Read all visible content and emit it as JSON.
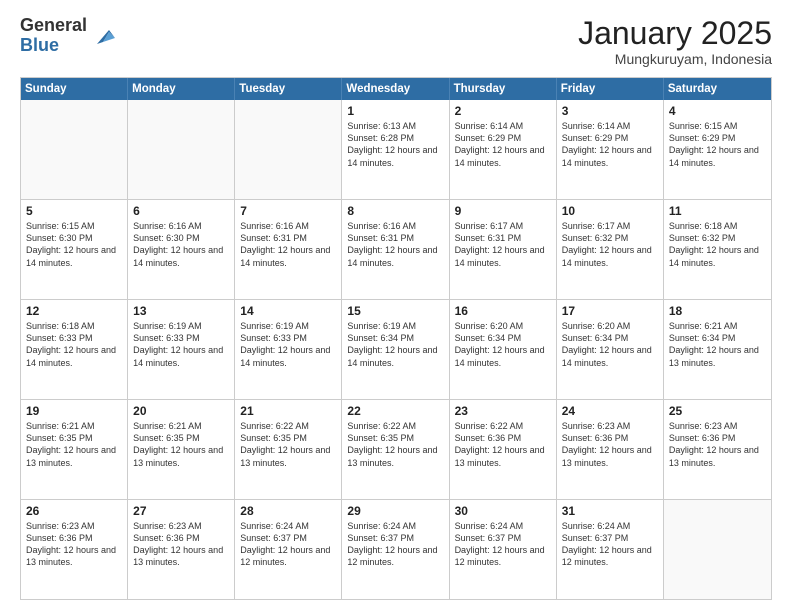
{
  "logo": {
    "general": "General",
    "blue": "Blue"
  },
  "header": {
    "month": "January 2025",
    "location": "Mungkuruyam, Indonesia"
  },
  "weekdays": [
    "Sunday",
    "Monday",
    "Tuesday",
    "Wednesday",
    "Thursday",
    "Friday",
    "Saturday"
  ],
  "weeks": [
    [
      {
        "day": "",
        "sunrise": "",
        "sunset": "",
        "daylight": ""
      },
      {
        "day": "",
        "sunrise": "",
        "sunset": "",
        "daylight": ""
      },
      {
        "day": "",
        "sunrise": "",
        "sunset": "",
        "daylight": ""
      },
      {
        "day": "1",
        "sunrise": "Sunrise: 6:13 AM",
        "sunset": "Sunset: 6:28 PM",
        "daylight": "Daylight: 12 hours and 14 minutes."
      },
      {
        "day": "2",
        "sunrise": "Sunrise: 6:14 AM",
        "sunset": "Sunset: 6:29 PM",
        "daylight": "Daylight: 12 hours and 14 minutes."
      },
      {
        "day": "3",
        "sunrise": "Sunrise: 6:14 AM",
        "sunset": "Sunset: 6:29 PM",
        "daylight": "Daylight: 12 hours and 14 minutes."
      },
      {
        "day": "4",
        "sunrise": "Sunrise: 6:15 AM",
        "sunset": "Sunset: 6:29 PM",
        "daylight": "Daylight: 12 hours and 14 minutes."
      }
    ],
    [
      {
        "day": "5",
        "sunrise": "Sunrise: 6:15 AM",
        "sunset": "Sunset: 6:30 PM",
        "daylight": "Daylight: 12 hours and 14 minutes."
      },
      {
        "day": "6",
        "sunrise": "Sunrise: 6:16 AM",
        "sunset": "Sunset: 6:30 PM",
        "daylight": "Daylight: 12 hours and 14 minutes."
      },
      {
        "day": "7",
        "sunrise": "Sunrise: 6:16 AM",
        "sunset": "Sunset: 6:31 PM",
        "daylight": "Daylight: 12 hours and 14 minutes."
      },
      {
        "day": "8",
        "sunrise": "Sunrise: 6:16 AM",
        "sunset": "Sunset: 6:31 PM",
        "daylight": "Daylight: 12 hours and 14 minutes."
      },
      {
        "day": "9",
        "sunrise": "Sunrise: 6:17 AM",
        "sunset": "Sunset: 6:31 PM",
        "daylight": "Daylight: 12 hours and 14 minutes."
      },
      {
        "day": "10",
        "sunrise": "Sunrise: 6:17 AM",
        "sunset": "Sunset: 6:32 PM",
        "daylight": "Daylight: 12 hours and 14 minutes."
      },
      {
        "day": "11",
        "sunrise": "Sunrise: 6:18 AM",
        "sunset": "Sunset: 6:32 PM",
        "daylight": "Daylight: 12 hours and 14 minutes."
      }
    ],
    [
      {
        "day": "12",
        "sunrise": "Sunrise: 6:18 AM",
        "sunset": "Sunset: 6:33 PM",
        "daylight": "Daylight: 12 hours and 14 minutes."
      },
      {
        "day": "13",
        "sunrise": "Sunrise: 6:19 AM",
        "sunset": "Sunset: 6:33 PM",
        "daylight": "Daylight: 12 hours and 14 minutes."
      },
      {
        "day": "14",
        "sunrise": "Sunrise: 6:19 AM",
        "sunset": "Sunset: 6:33 PM",
        "daylight": "Daylight: 12 hours and 14 minutes."
      },
      {
        "day": "15",
        "sunrise": "Sunrise: 6:19 AM",
        "sunset": "Sunset: 6:34 PM",
        "daylight": "Daylight: 12 hours and 14 minutes."
      },
      {
        "day": "16",
        "sunrise": "Sunrise: 6:20 AM",
        "sunset": "Sunset: 6:34 PM",
        "daylight": "Daylight: 12 hours and 14 minutes."
      },
      {
        "day": "17",
        "sunrise": "Sunrise: 6:20 AM",
        "sunset": "Sunset: 6:34 PM",
        "daylight": "Daylight: 12 hours and 14 minutes."
      },
      {
        "day": "18",
        "sunrise": "Sunrise: 6:21 AM",
        "sunset": "Sunset: 6:34 PM",
        "daylight": "Daylight: 12 hours and 13 minutes."
      }
    ],
    [
      {
        "day": "19",
        "sunrise": "Sunrise: 6:21 AM",
        "sunset": "Sunset: 6:35 PM",
        "daylight": "Daylight: 12 hours and 13 minutes."
      },
      {
        "day": "20",
        "sunrise": "Sunrise: 6:21 AM",
        "sunset": "Sunset: 6:35 PM",
        "daylight": "Daylight: 12 hours and 13 minutes."
      },
      {
        "day": "21",
        "sunrise": "Sunrise: 6:22 AM",
        "sunset": "Sunset: 6:35 PM",
        "daylight": "Daylight: 12 hours and 13 minutes."
      },
      {
        "day": "22",
        "sunrise": "Sunrise: 6:22 AM",
        "sunset": "Sunset: 6:35 PM",
        "daylight": "Daylight: 12 hours and 13 minutes."
      },
      {
        "day": "23",
        "sunrise": "Sunrise: 6:22 AM",
        "sunset": "Sunset: 6:36 PM",
        "daylight": "Daylight: 12 hours and 13 minutes."
      },
      {
        "day": "24",
        "sunrise": "Sunrise: 6:23 AM",
        "sunset": "Sunset: 6:36 PM",
        "daylight": "Daylight: 12 hours and 13 minutes."
      },
      {
        "day": "25",
        "sunrise": "Sunrise: 6:23 AM",
        "sunset": "Sunset: 6:36 PM",
        "daylight": "Daylight: 12 hours and 13 minutes."
      }
    ],
    [
      {
        "day": "26",
        "sunrise": "Sunrise: 6:23 AM",
        "sunset": "Sunset: 6:36 PM",
        "daylight": "Daylight: 12 hours and 13 minutes."
      },
      {
        "day": "27",
        "sunrise": "Sunrise: 6:23 AM",
        "sunset": "Sunset: 6:36 PM",
        "daylight": "Daylight: 12 hours and 13 minutes."
      },
      {
        "day": "28",
        "sunrise": "Sunrise: 6:24 AM",
        "sunset": "Sunset: 6:37 PM",
        "daylight": "Daylight: 12 hours and 12 minutes."
      },
      {
        "day": "29",
        "sunrise": "Sunrise: 6:24 AM",
        "sunset": "Sunset: 6:37 PM",
        "daylight": "Daylight: 12 hours and 12 minutes."
      },
      {
        "day": "30",
        "sunrise": "Sunrise: 6:24 AM",
        "sunset": "Sunset: 6:37 PM",
        "daylight": "Daylight: 12 hours and 12 minutes."
      },
      {
        "day": "31",
        "sunrise": "Sunrise: 6:24 AM",
        "sunset": "Sunset: 6:37 PM",
        "daylight": "Daylight: 12 hours and 12 minutes."
      },
      {
        "day": "",
        "sunrise": "",
        "sunset": "",
        "daylight": ""
      }
    ]
  ]
}
